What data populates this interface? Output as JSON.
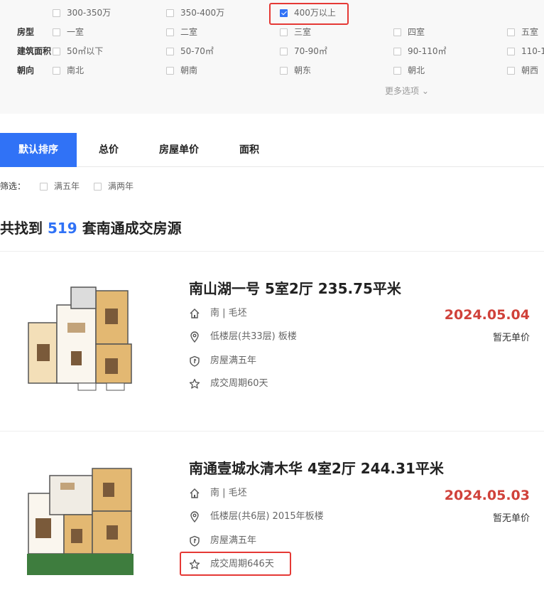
{
  "filters": {
    "price_row": {
      "options": [
        {
          "label": "300-350万",
          "checked": false
        },
        {
          "label": "350-400万",
          "checked": false
        },
        {
          "label": "400万以上",
          "checked": true
        }
      ]
    },
    "layout_row": {
      "label": "房型",
      "options": [
        "一室",
        "二室",
        "三室",
        "四室",
        "五室"
      ]
    },
    "area_row": {
      "label": "建筑面积",
      "options": [
        "50㎡以下",
        "50-70㎡",
        "70-90㎡",
        "90-110㎡",
        "110-1"
      ]
    },
    "orientation_row": {
      "label": "朝向",
      "options": [
        "南北",
        "朝南",
        "朝东",
        "朝北",
        "朝西"
      ]
    },
    "more_options": "更多选项 ⌄"
  },
  "sort_tabs": [
    {
      "label": "默认排序",
      "active": true
    },
    {
      "label": "总价",
      "active": false
    },
    {
      "label": "房屋单价",
      "active": false
    },
    {
      "label": "面积",
      "active": false
    }
  ],
  "screening": {
    "label": "筛选：",
    "options": [
      "满五年",
      "满两年"
    ]
  },
  "results": {
    "prefix": "共找到",
    "count": "519",
    "suffix": "套南通成交房源"
  },
  "listings": [
    {
      "title": "南山湖一号 5室2厅 235.75平米",
      "orientation": "南 | 毛坯",
      "floor": "低楼层(共33层) 板楼",
      "tag": "房屋满五年",
      "period": "成交周期60天",
      "date": "2024.05.04",
      "unit_price": "暂无单价"
    },
    {
      "title": "南通壹城水清木华 4室2厅 244.31平米",
      "orientation": "南 | 毛坯",
      "floor": "低楼层(共6层) 2015年板楼",
      "tag": "房屋满五年",
      "period": "成交周期646天",
      "date": "2024.05.03",
      "unit_price": "暂无单价"
    }
  ],
  "colors": {
    "accent": "#3072f6",
    "date_red": "#d0413a",
    "highlight_box": "#e53935"
  }
}
